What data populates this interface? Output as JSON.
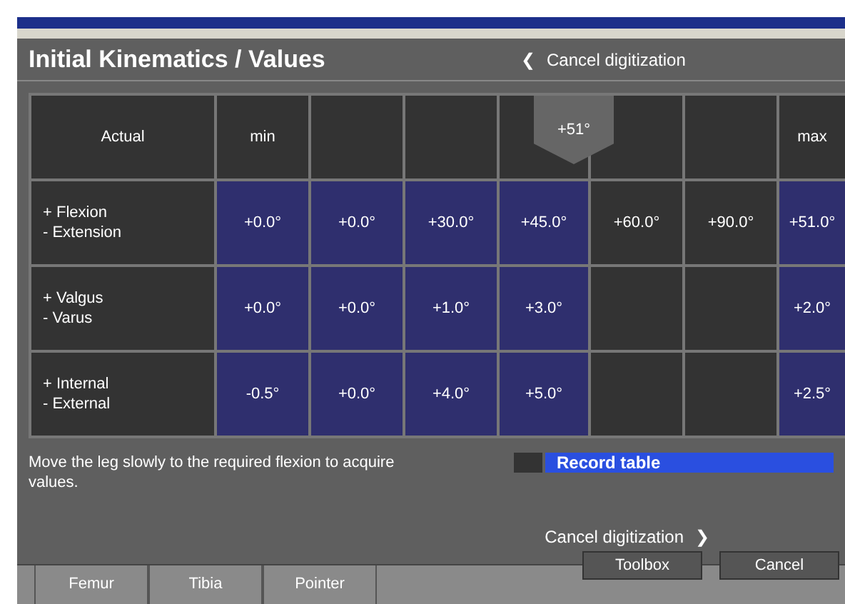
{
  "header": {
    "title": "Initial Kinematics / Values",
    "cancel_link": "Cancel digitization",
    "cancel_icon": "❮"
  },
  "table": {
    "corner": "Actual",
    "columns": [
      "min",
      "",
      "",
      "",
      "",
      "",
      "max"
    ],
    "marker": {
      "label": "+51°"
    },
    "rows": [
      {
        "label": [
          "+ Flexion",
          "- Extension"
        ],
        "cells": [
          {
            "text": "+0.0°",
            "highlighted": true
          },
          {
            "text": "+0.0°",
            "highlighted": true
          },
          {
            "text": "+30.0°",
            "highlighted": true
          },
          {
            "text": "+45.0°",
            "highlighted": true
          },
          {
            "text": "+60.0°",
            "highlighted": false
          },
          {
            "text": "+90.0°",
            "highlighted": false
          },
          {
            "text": "+51.0°",
            "highlighted": true
          }
        ]
      },
      {
        "label": [
          "+ Valgus",
          "- Varus"
        ],
        "cells": [
          {
            "text": "+0.0°",
            "highlighted": true
          },
          {
            "text": "+0.0°",
            "highlighted": true
          },
          {
            "text": "+1.0°",
            "highlighted": true
          },
          {
            "text": "+3.0°",
            "highlighted": true
          },
          {
            "text": "",
            "highlighted": false
          },
          {
            "text": "",
            "highlighted": false
          },
          {
            "text": "+2.0°",
            "highlighted": true
          }
        ]
      },
      {
        "label": [
          "+ Internal",
          "- External"
        ],
        "cells": [
          {
            "text": "-0.5°",
            "highlighted": true
          },
          {
            "text": "+0.0°",
            "highlighted": true
          },
          {
            "text": "+4.0°",
            "highlighted": true
          },
          {
            "text": "+5.0°",
            "highlighted": true
          },
          {
            "text": "",
            "highlighted": false
          },
          {
            "text": "",
            "highlighted": false
          },
          {
            "text": "+2.5°",
            "highlighted": true
          }
        ]
      }
    ]
  },
  "instruction": "Move the leg slowly to the required flexion to acquire values.",
  "record": {
    "label": "Record table",
    "checked": false
  },
  "next_link": {
    "label": "Cancel digitization",
    "icon": "❯"
  },
  "tabs": [
    "Femur",
    "Tibia",
    "Pointer"
  ],
  "buttons": [
    "Toolbox",
    "Cancel"
  ]
}
